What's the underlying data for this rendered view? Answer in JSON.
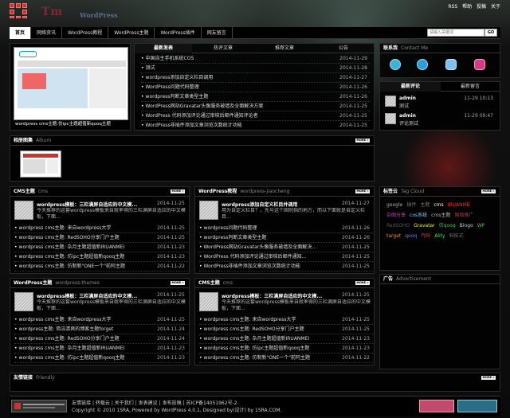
{
  "header": {
    "logo_word": "Tm",
    "logo_word2": "WordPress",
    "top_links": [
      "RSS",
      "帮助",
      "投稿",
      "关于"
    ]
  },
  "nav": {
    "items": [
      "首页",
      "网络资讯",
      "WordPress教程",
      "WordPress主题",
      "WordPress插件",
      "网友留言"
    ],
    "search_placeholder": "请输入关键词",
    "go": "GO"
  },
  "slider": {
    "caption": "wordpress cms主题:仿ipc主题超值新qooq主题"
  },
  "news_tabs": [
    "最新发表",
    "热评文章",
    "推荐文章",
    "公告"
  ],
  "news": [
    {
      "t": "中国自主手机系统COS",
      "d": "2014-11-29"
    },
    {
      "t": "测试",
      "d": "2014-11-28"
    },
    {
      "t": "wordpress添加自定义栏目调用",
      "d": "2014-11-27"
    },
    {
      "t": "WordPress问题代码整理",
      "d": "2014-11-26"
    },
    {
      "t": "wordpress判断文章类型主题",
      "d": "2014-11-26"
    },
    {
      "t": "WordPress网站Gravatar头像服务被墙及全面解决方案",
      "d": "2014-11-25"
    },
    {
      "t": "WordPress 代码添加评论通过审核后邮件通知评论者",
      "d": "2014-11-25"
    },
    {
      "t": "WordPress非插件添加文章浏览次数统计功能",
      "d": "2014-11-25"
    }
  ],
  "contact": {
    "title": "联系我",
    "sub": "Contact Me"
  },
  "comment_tabs": [
    "最新评论",
    "最新留言"
  ],
  "comments": [
    {
      "user": "admin",
      "text": "测试",
      "time": "11-29 10:13"
    },
    {
      "user": "admin",
      "text": "评论测试",
      "time": "11-29 09:47"
    }
  ],
  "album": {
    "title": "相册图集",
    "sub": "Album",
    "more": "MORE »"
  },
  "tags": {
    "title": "标签云",
    "sub": "Tag Cloud",
    "more": "MORE »",
    "items": [
      {
        "t": "google",
        "c": "#aaa"
      },
      {
        "t": "插件",
        "c": "#777"
      },
      {
        "t": "主题",
        "c": "#777"
      },
      {
        "t": "cms",
        "c": "#fff"
      },
      {
        "t": "IRUANME",
        "c": "#e33"
      },
      {
        "t": "杂图分享",
        "c": "#c3c"
      },
      {
        "t": "cos系统",
        "c": "#7cf"
      },
      {
        "t": "cms主题",
        "c": "#bbb"
      },
      {
        "t": "网络推广",
        "c": "#c33"
      },
      {
        "t": "RedSOHO",
        "c": "#555"
      },
      {
        "t": "Gravatar",
        "c": "#ee3"
      },
      {
        "t": "仿qooq",
        "c": "#3c3"
      },
      {
        "t": "Bingo",
        "c": "#ccc"
      },
      {
        "t": "WP",
        "c": "#3c3"
      },
      {
        "t": "target",
        "c": "#e83"
      },
      {
        "t": "qooq",
        "c": "#77e"
      },
      {
        "t": "代码",
        "c": "#e33"
      },
      {
        "t": "Ality",
        "c": "#3e3"
      },
      {
        "t": "科技式",
        "c": "#777"
      }
    ]
  },
  "ad": {
    "title": "广告",
    "sub": "Advertisement"
  },
  "friendly": {
    "title": "友情链接",
    "sub": "Friendly",
    "more": "MORE »"
  },
  "sections": [
    {
      "title": "CMS主题",
      "sub": "cms",
      "more": "MORE »",
      "feat_title": "wordpress模板：三栏满屏自适应的中文模...",
      "feat_date": "2014-11-25",
      "feat_desc": "今天推荐的这套wordpress模板来自就率得的三栏满屏自适应的中文模板，下面...",
      "rows": [
        {
          "t": "wordpress cms主题: 来自wordpress大学",
          "d": "2014-11-25"
        },
        {
          "t": "wordpress cms主题: RedSOHO分享门户主题",
          "d": "2014-11-25"
        },
        {
          "t": "wordpress cms主题: 杂月主题超值新IRUANMEI",
          "d": "2014-11-23"
        },
        {
          "t": "wordpress cms主题: 仿ipc主题超值新qooq主题",
          "d": "2014-11-23"
        },
        {
          "t": "wordpress cms主题: 仿制新\"ONE一个\"前阿主题",
          "d": "2014-11-22"
        }
      ]
    },
    {
      "title": "WordPress教程",
      "sub": "wordpress-jiaocheng",
      "more": "MORE »",
      "feat_title": "wordpress添加自定义栏目并调用",
      "feat_date": "2014-11-27",
      "feat_desc": "用为自定义栏目？，先与这个固则指的地方，而以下面就是自定义栏目...",
      "rows": [
        {
          "t": "wordpress问题代码整理",
          "d": "2014-11-26"
        },
        {
          "t": "wordpress判断文章类型主题",
          "d": "2014-11-26"
        },
        {
          "t": "WordPress网站Gravatar头像服务被墙及全面解决...",
          "d": "2014-11-25"
        },
        {
          "t": "WordPress 代码添加评论通过审核后邮件通知...",
          "d": "2014-11-25"
        },
        {
          "t": "WordPress非插件添加文章浏览次数统计功能",
          "d": "2014-11-25"
        }
      ]
    },
    {
      "title": "WordPress主题",
      "sub": "wordpress-themes",
      "more": "MORE »",
      "feat_title": "wordpress模板：三栏满屏自适应的中文模...",
      "feat_date": "2014-11-25",
      "feat_desc": "今天推荐的这套wordpress模板来自就率得的三栏满屏自适应的中文模板，下面...",
      "rows": [
        {
          "t": "wordpress cms主题: 来自wordpress大学",
          "d": "2014-11-25"
        },
        {
          "t": "wordpress主题: 简洁清爽的博客主题forget",
          "d": "2014-11-24"
        },
        {
          "t": "wordpress cms主题: RedSOHO分享门户主题",
          "d": "2014-11-24"
        },
        {
          "t": "wordpress cms主题: 杂月主题超值新IRUANMEI",
          "d": "2014-11-23"
        },
        {
          "t": "wordpress cms主题: 仿ipc主题超值新qooq主题",
          "d": "2014-11-23"
        }
      ]
    },
    {
      "title": "CMS主题",
      "sub": "cms",
      "more": "MORE »",
      "feat_title": "wordpress模板：三栏满屏自适应的中文模...",
      "feat_date": "2014-11-25",
      "feat_desc": "今天推荐的这套wordpress模板来自就率得的三栏满屏自适应的中文模板，下面...",
      "rows": [
        {
          "t": "wordpress cms主题: 来自wordpress大学",
          "d": "2014-11-25"
        },
        {
          "t": "wordpress cms主题: RedSOHO分享门户主题",
          "d": "2014-11-25"
        },
        {
          "t": "wordpress cms主题: 杂月主题超值新IRUANMEI",
          "d": "2014-11-23"
        },
        {
          "t": "wordpress cms主题: 仿ipc主题超值新qooq主题",
          "d": "2014-11-23"
        },
        {
          "t": "wordpress cms主题: 仿制新\"ONE一个\"前阿主题",
          "d": "2014-11-22"
        }
      ]
    }
  ],
  "footer": {
    "links": [
      "友情链接",
      "|",
      "转载云",
      "|",
      "关于我们",
      "|",
      "发表建议",
      "|",
      "发布投稿",
      "|",
      "苏ICP备14051962号-2"
    ],
    "copyright": "Copyright © 2010 1SRA, Powered by WordPress 4.0.1, Designed by(设计) by 1SRA.COM."
  }
}
